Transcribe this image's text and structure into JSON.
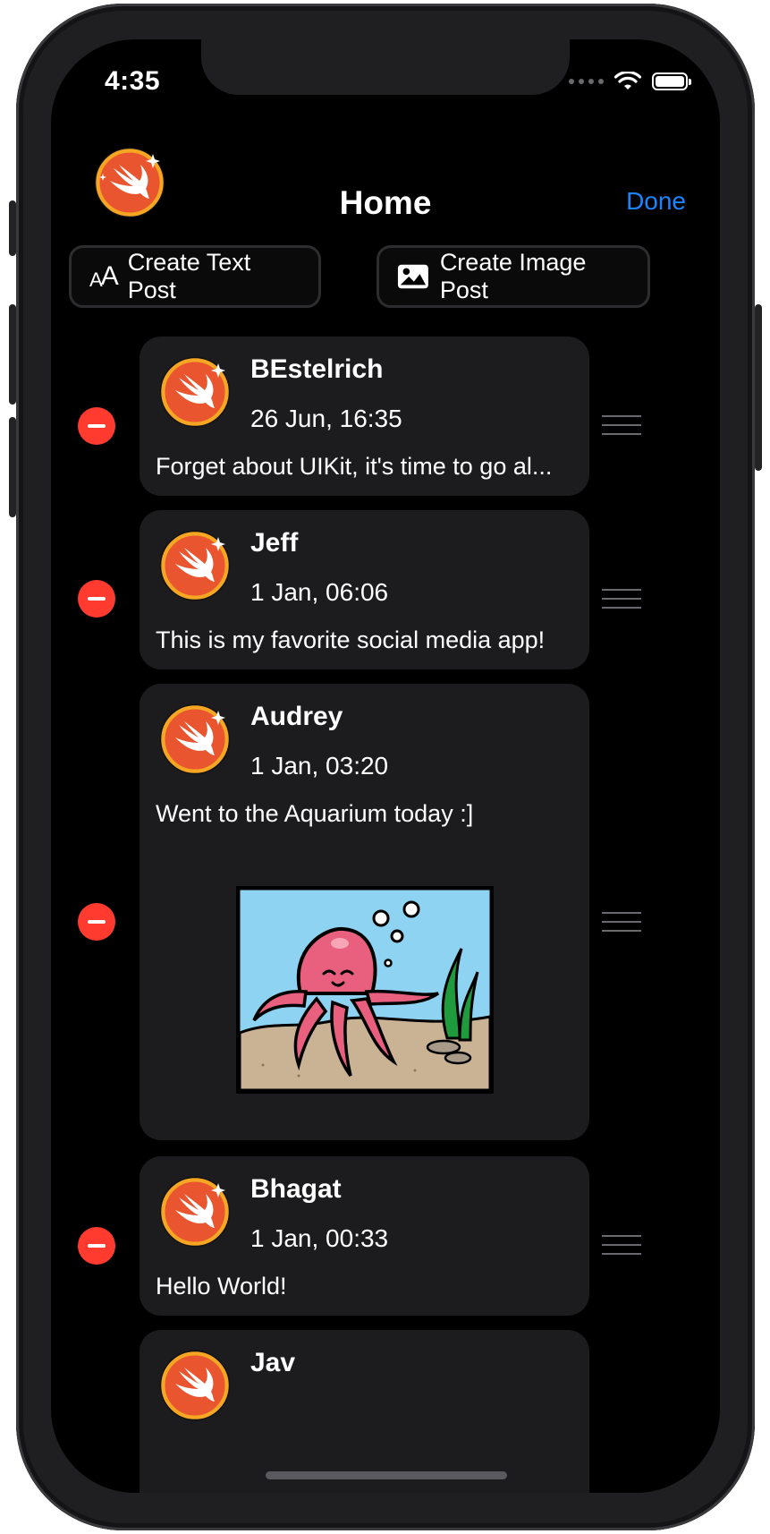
{
  "status_bar": {
    "time": "4:35"
  },
  "nav": {
    "title": "Home",
    "done_label": "Done"
  },
  "actions": {
    "text_post_label": "Create Text Post",
    "image_post_label": "Create Image Post"
  },
  "posts": [
    {
      "author": "BEstelrich",
      "time": "26 Jun, 16:35",
      "text": "Forget about UIKit, it's time to go al..."
    },
    {
      "author": "Jeff",
      "time": "1 Jan, 06:06",
      "text": "This is my favorite social media app!"
    },
    {
      "author": "Audrey",
      "time": "1 Jan, 03:20",
      "text": "Went to the Aquarium today :]",
      "image": "octopus-aquarium-illustration"
    },
    {
      "author": "Bhagat",
      "time": "1 Jan, 00:33",
      "text": "Hello World!"
    },
    {
      "author": "Jav"
    }
  ],
  "icons": {
    "avatar": "swift-bird-logo",
    "text_post": "text-size-icon",
    "image_post": "photo-icon",
    "delete": "minus-circle-icon",
    "reorder": "reorder-handle-icon"
  },
  "colors": {
    "accent": "#1a84ff",
    "delete": "#ff3b30",
    "card": "#1c1c1e",
    "background": "#000000"
  }
}
